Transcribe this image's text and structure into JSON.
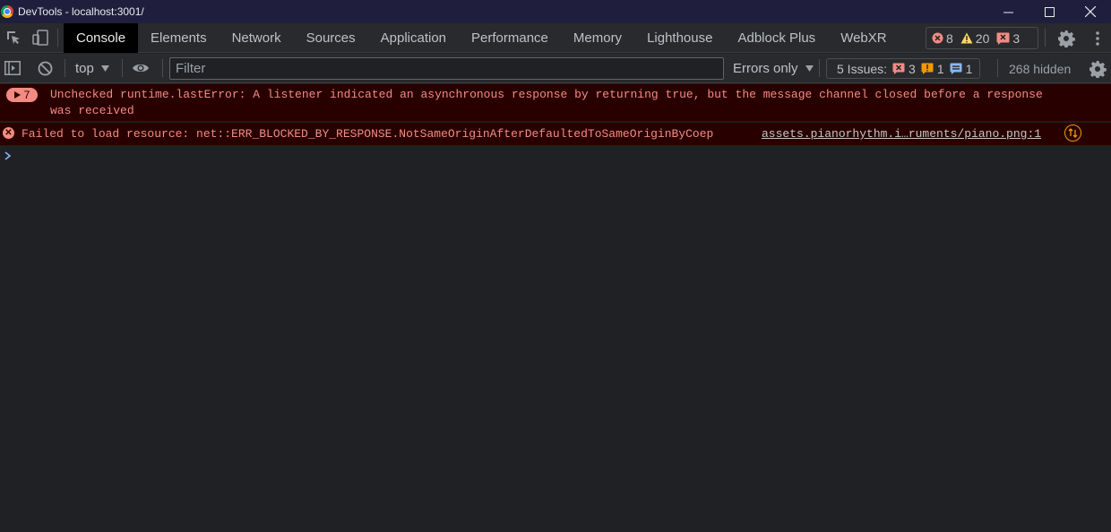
{
  "window": {
    "title": "DevTools - localhost:3001/"
  },
  "tabs": [
    {
      "label": "Console",
      "active": true
    },
    {
      "label": "Elements"
    },
    {
      "label": "Network"
    },
    {
      "label": "Sources"
    },
    {
      "label": "Application"
    },
    {
      "label": "Performance"
    },
    {
      "label": "Memory"
    },
    {
      "label": "Lighthouse"
    },
    {
      "label": "Adblock Plus"
    },
    {
      "label": "WebXR"
    }
  ],
  "counters": {
    "errors": "8",
    "warnings": "20",
    "issues": "3"
  },
  "toolbar": {
    "context": "top",
    "filter_placeholder": "Filter",
    "levels": "Errors only",
    "issues_label": "5 Issues:",
    "issues_errors": "3",
    "issues_warnings": "1",
    "issues_info": "1",
    "hidden": "268 hidden"
  },
  "messages": [
    {
      "repeat": "7",
      "text": "Unchecked runtime.lastError: A listener indicated an asynchronous response by returning true, but the message channel closed before a response was received"
    },
    {
      "text": "Failed to load resource: net::ERR_BLOCKED_BY_RESPONSE.NotSameOriginAfterDefaultedToSameOriginByCoep",
      "source": "assets.pianorhythm.i…ruments/piano.png:1"
    }
  ],
  "colors": {
    "error_bg": "#290000",
    "error_text": "#f28b82",
    "accent": "#8ab4f8"
  }
}
